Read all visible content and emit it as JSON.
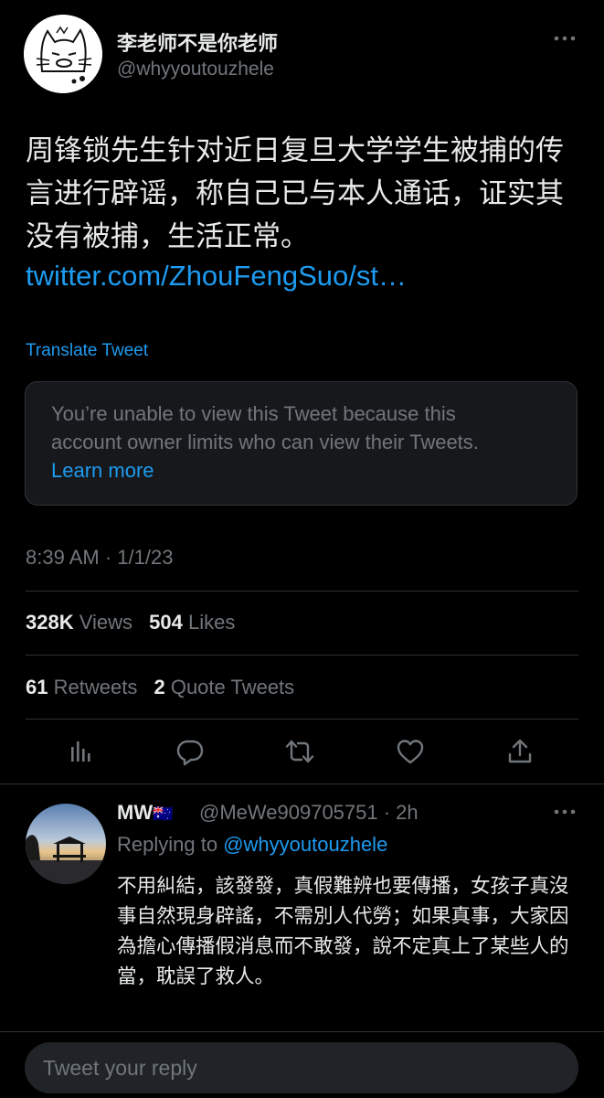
{
  "tweet": {
    "author": {
      "display_name": "李老师不是你老师",
      "handle": "@whyyoutouzhele",
      "avatar_icon": "cat-doodle-avatar"
    },
    "text": "周锋锁先生针对近日复旦大学学生被捕的传言进行辟谣，称自己已与本人通话，证实其没有被捕，生活正常。",
    "link": "twitter.com/ZhouFengSuo/st…",
    "translate_label": "Translate Tweet",
    "quoted_tweet_notice": {
      "line1": "You’re unable to view this Tweet because this",
      "line2": "account owner limits who can view their Tweets.",
      "learn_more": "Learn more"
    },
    "timestamp": "8:39 AM · 1/1/23",
    "stats": {
      "views_count": "328K",
      "views_label": "Views",
      "likes_count": "504",
      "likes_label": "Likes",
      "retweets_count": "61",
      "retweets_label": "Retweets",
      "quotes_count": "2",
      "quotes_label": "Quote Tweets"
    },
    "actions": [
      "analytics-icon",
      "reply-icon",
      "retweet-icon",
      "like-icon",
      "share-icon"
    ]
  },
  "reply": {
    "display_name": "MW",
    "flag": "🇦🇺",
    "handle_time": "@MeWe909705751 · 2h",
    "replying_prefix": "Replying to",
    "replying_to": "@whyyoutouzhele",
    "text": "不用糾結，該發發，真假難辨也要傳播，女孩子真沒事自然現身辟謠，不需別人代勞；如果真事，大家因為擔心傳播假消息而不敢發，說不定真上了某些人的當，耽誤了救人。"
  },
  "compose": {
    "placeholder": "Tweet your reply"
  },
  "colors": {
    "background": "#000000",
    "accent": "#1d9bf0",
    "text_primary": "#e7e9ea",
    "text_secondary": "#71767b",
    "divider": "#2f3336"
  }
}
